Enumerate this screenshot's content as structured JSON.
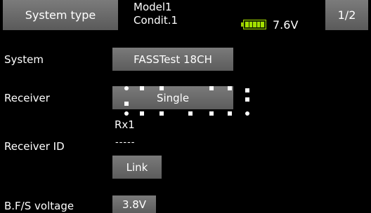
{
  "header": {
    "title": "System type",
    "model_name": "Model1",
    "condition": "Condit.1",
    "voltage": "7.6V",
    "page": "1/2"
  },
  "rows": {
    "system_label": "System",
    "system_value": "FASSTest 18CH",
    "receiver_label": "Receiver",
    "receiver_value": "Single",
    "rx_label": "Rx1",
    "receiver_id_label": "Receiver ID",
    "receiver_id_value": "-----",
    "link_label": "Link",
    "bfs_label": "B.F/S voltage",
    "bfs_value": "3.8V"
  },
  "colors": {
    "background": "#000000",
    "button": "#6b6b6b",
    "battery": "#a4e000"
  },
  "icons": {
    "battery": "battery-icon"
  }
}
